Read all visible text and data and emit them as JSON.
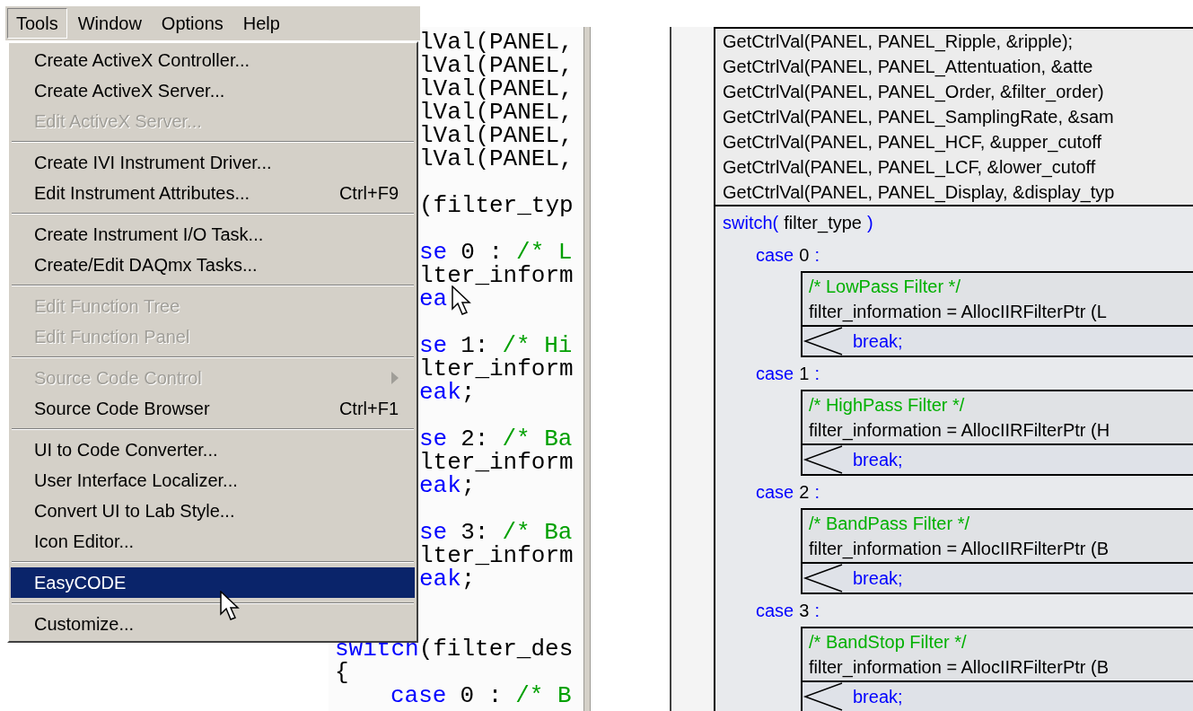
{
  "menu_bar": {
    "items": [
      {
        "label": "Tools",
        "selected": true
      },
      {
        "label": "Window",
        "selected": false
      },
      {
        "label": "Options",
        "selected": false
      },
      {
        "label": "Help",
        "selected": false
      }
    ]
  },
  "tools_menu": {
    "items": [
      {
        "kind": "item",
        "label": "Create ActiveX Controller...",
        "disabled": false,
        "selected": false,
        "submenu": false
      },
      {
        "kind": "item",
        "label": "Create ActiveX Server...",
        "disabled": false,
        "selected": false,
        "submenu": false
      },
      {
        "kind": "item",
        "label": "Edit ActiveX Server...",
        "disabled": true,
        "selected": false,
        "submenu": false
      },
      {
        "kind": "separator"
      },
      {
        "kind": "item",
        "label": "Create IVI Instrument Driver...",
        "disabled": false,
        "selected": false,
        "submenu": false
      },
      {
        "kind": "item",
        "label": "Edit Instrument Attributes...",
        "shortcut": "Ctrl+F9",
        "disabled": false,
        "selected": false,
        "submenu": false
      },
      {
        "kind": "separator"
      },
      {
        "kind": "item",
        "label": "Create Instrument I/O Task...",
        "disabled": false,
        "selected": false,
        "submenu": false
      },
      {
        "kind": "item",
        "label": "Create/Edit DAQmx Tasks...",
        "disabled": false,
        "selected": false,
        "submenu": false
      },
      {
        "kind": "separator"
      },
      {
        "kind": "item",
        "label": "Edit Function Tree",
        "disabled": true,
        "selected": false,
        "submenu": false
      },
      {
        "kind": "item",
        "label": "Edit Function Panel",
        "disabled": true,
        "selected": false,
        "submenu": false
      },
      {
        "kind": "separator"
      },
      {
        "kind": "item",
        "label": "Source Code Control",
        "disabled": true,
        "selected": false,
        "submenu": true
      },
      {
        "kind": "item",
        "label": "Source Code Browser",
        "shortcut": "Ctrl+F1",
        "disabled": false,
        "selected": false,
        "submenu": false
      },
      {
        "kind": "separator"
      },
      {
        "kind": "item",
        "label": "UI to Code Converter...",
        "disabled": false,
        "selected": false,
        "submenu": false
      },
      {
        "kind": "item",
        "label": "User Interface Localizer...",
        "disabled": false,
        "selected": false,
        "submenu": false
      },
      {
        "kind": "item",
        "label": "Convert UI to Lab Style...",
        "disabled": false,
        "selected": false,
        "submenu": false
      },
      {
        "kind": "item",
        "label": "Icon Editor...",
        "disabled": false,
        "selected": false,
        "submenu": false
      },
      {
        "kind": "separator"
      },
      {
        "kind": "item",
        "label": "EasyCODE",
        "disabled": false,
        "selected": true,
        "submenu": false
      },
      {
        "kind": "separator"
      },
      {
        "kind": "item",
        "label": "Customize...",
        "disabled": false,
        "selected": false,
        "submenu": false
      }
    ]
  },
  "code_editor": {
    "beside_menu": [
      {
        "lines": [
          {
            "segments": [
              {
                "text": "lVal(PANEL,",
                "kind": "plain"
              }
            ]
          },
          {
            "segments": [
              {
                "text": "lVal(PANEL,",
                "kind": "plain"
              }
            ]
          },
          {
            "segments": [
              {
                "text": "lVal(PANEL,",
                "kind": "plain"
              }
            ]
          },
          {
            "segments": [
              {
                "text": "lVal(PANEL,",
                "kind": "plain"
              }
            ]
          },
          {
            "segments": [
              {
                "text": "lVal(PANEL,",
                "kind": "plain"
              }
            ]
          },
          {
            "segments": [
              {
                "text": "lVal(PANEL,",
                "kind": "plain"
              }
            ]
          }
        ]
      },
      {
        "lines": [
          {
            "segments": [
              {
                "text": "(filter_typ",
                "kind": "plain"
              }
            ]
          }
        ]
      },
      {
        "lines": [
          {
            "segments": [
              {
                "text": "se",
                "kind": "keyword"
              },
              {
                "text": "0 :",
                "kind": "plain"
              },
              {
                "text": "/* L",
                "kind": "comment"
              }
            ]
          },
          {
            "segments": [
              {
                "text": "lter_inform",
                "kind": "plain"
              }
            ]
          },
          {
            "segments": [
              {
                "text": "ea",
                "kind": "keyword"
              }
            ]
          }
        ]
      },
      {
        "lines": [
          {
            "segments": [
              {
                "text": "se",
                "kind": "keyword"
              },
              {
                "text": "1:",
                "kind": "plain"
              },
              {
                "text": "/* Hi",
                "kind": "comment"
              }
            ]
          },
          {
            "segments": [
              {
                "text": "lter_inform",
                "kind": "plain"
              }
            ]
          },
          {
            "segments": [
              {
                "text": "eak",
                "kind": "keyword"
              },
              {
                "text": ";",
                "kind": "plain",
                "attached": true
              }
            ]
          }
        ]
      },
      {
        "lines": [
          {
            "segments": [
              {
                "text": "se",
                "kind": "keyword"
              },
              {
                "text": "2:",
                "kind": "plain"
              },
              {
                "text": "/* Ba",
                "kind": "comment"
              }
            ]
          },
          {
            "segments": [
              {
                "text": "lter_inform",
                "kind": "plain"
              }
            ]
          },
          {
            "segments": [
              {
                "text": "eak",
                "kind": "keyword"
              },
              {
                "text": ";",
                "kind": "plain",
                "attached": true
              }
            ]
          }
        ]
      },
      {
        "lines": [
          {
            "segments": [
              {
                "text": "se",
                "kind": "keyword"
              },
              {
                "text": "3:",
                "kind": "plain"
              },
              {
                "text": "/* Ba",
                "kind": "comment"
              }
            ]
          },
          {
            "segments": [
              {
                "text": "lter_inform",
                "kind": "plain"
              }
            ]
          },
          {
            "segments": [
              {
                "text": "eak",
                "kind": "keyword"
              },
              {
                "text": ";",
                "kind": "plain",
                "attached": true
              }
            ]
          }
        ]
      }
    ],
    "below_menu": [
      {
        "segments": [
          {
            "text": "switch",
            "kind": "keyword"
          },
          {
            "text": "(filter_des",
            "kind": "plain",
            "attached": true
          }
        ]
      },
      {
        "segments": [
          {
            "text": "{",
            "kind": "plain"
          }
        ],
        "children": [
          {
            "segments": [
              {
                "text": "case",
                "kind": "keyword"
              },
              {
                "text": "0 :",
                "kind": "plain"
              },
              {
                "text": "/* B",
                "kind": "comment"
              }
            ]
          }
        ]
      }
    ]
  },
  "structure_diagram": {
    "statements": [
      "GetCtrlVal(PANEL, PANEL_Ripple, &ripple);",
      "GetCtrlVal(PANEL, PANEL_Attentuation, &atte",
      "GetCtrlVal(PANEL, PANEL_Order, &filter_order)",
      "GetCtrlVal(PANEL, PANEL_SamplingRate, &sam",
      "GetCtrlVal(PANEL, PANEL_HCF, &upper_cutoff",
      "GetCtrlVal(PANEL, PANEL_LCF, &lower_cutoff",
      "GetCtrlVal(PANEL, PANEL_Display, &display_typ"
    ],
    "switch": {
      "header": [
        {
          "text": "switch(",
          "kind": "keyword"
        },
        {
          "text": "filter_type",
          "kind": "plain"
        },
        {
          "text": ")",
          "kind": "keyword"
        }
      ],
      "cases": [
        {
          "label": [
            {
              "text": "case",
              "kind": "keyword"
            },
            {
              "text": "0",
              "kind": "plain"
            },
            {
              "text": ":",
              "kind": "keyword"
            }
          ],
          "comment": "/* LowPass Filter */",
          "statement": "filter_information = AllocIIRFilterPtr (L",
          "exit": "break;"
        },
        {
          "label": [
            {
              "text": "case",
              "kind": "keyword"
            },
            {
              "text": "1",
              "kind": "plain"
            },
            {
              "text": ":",
              "kind": "keyword"
            }
          ],
          "comment": "/* HighPass Filter */",
          "statement": "filter_information = AllocIIRFilterPtr (H",
          "exit": "break;"
        },
        {
          "label": [
            {
              "text": "case",
              "kind": "keyword"
            },
            {
              "text": "2",
              "kind": "plain"
            },
            {
              "text": ":",
              "kind": "keyword"
            }
          ],
          "comment": "/* BandPass Filter */",
          "statement": "filter_information = AllocIIRFilterPtr (B",
          "exit": "break;"
        },
        {
          "label": [
            {
              "text": "case",
              "kind": "keyword"
            },
            {
              "text": "3",
              "kind": "plain"
            },
            {
              "text": ":",
              "kind": "keyword"
            }
          ],
          "comment": "/* BandStop Filter */",
          "statement": "filter_information = AllocIIRFilterPtr (B",
          "exit": "break;"
        }
      ]
    }
  }
}
